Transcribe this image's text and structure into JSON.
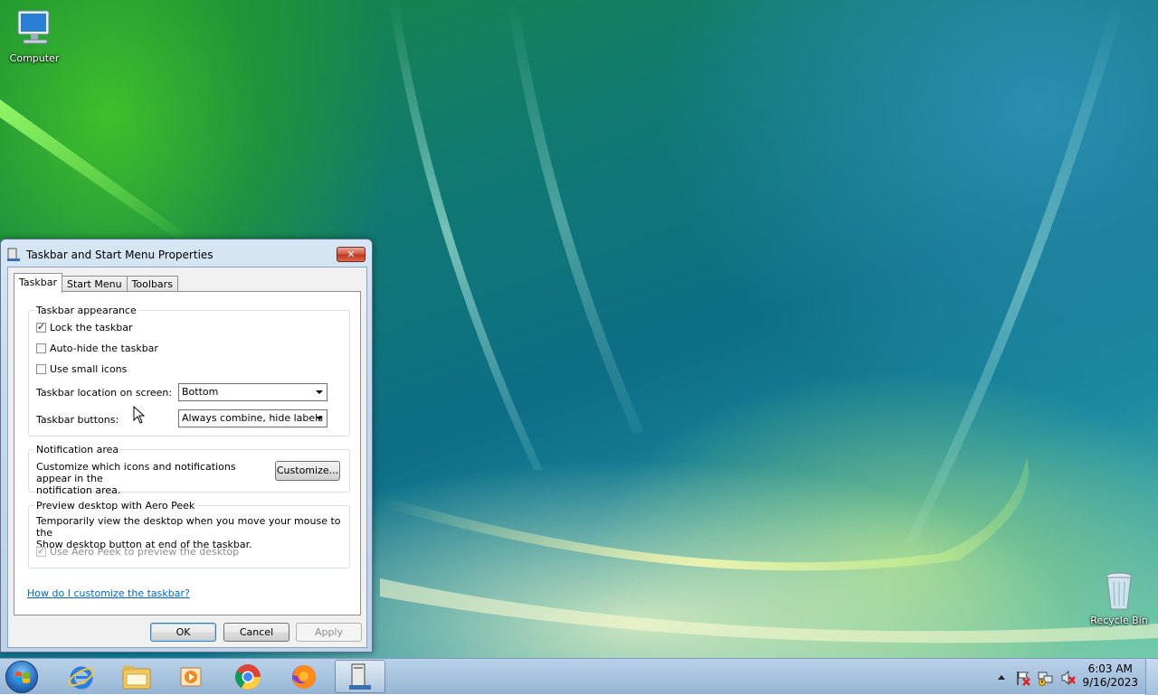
{
  "desktop": {
    "icons": [
      {
        "label": "Computer",
        "icon": "computer-icon"
      },
      {
        "label": "Recycle Bin",
        "icon": "recycle-bin-icon"
      }
    ]
  },
  "dialog": {
    "title": "Taskbar and Start Menu Properties",
    "close_label": "✕",
    "tabs": [
      {
        "label": "Taskbar",
        "active": true
      },
      {
        "label": "Start Menu",
        "active": false
      },
      {
        "label": "Toolbars",
        "active": false
      }
    ],
    "appearance": {
      "title": "Taskbar appearance",
      "lock_label": "Lock the taskbar",
      "lock_checked": true,
      "autohide_label": "Auto-hide the taskbar",
      "autohide_checked": false,
      "small_icons_label": "Use small icons",
      "small_icons_checked": false,
      "location_label": "Taskbar location on screen:",
      "location_value": "Bottom",
      "buttons_label": "Taskbar buttons:",
      "buttons_value": "Always combine, hide labels"
    },
    "notification": {
      "title": "Notification area",
      "text_line1": "Customize which icons and notifications appear in the",
      "text_line2": "notification area.",
      "customize_label": "Customize..."
    },
    "aero_peek": {
      "title": "Preview desktop with Aero Peek",
      "text_line1": "Temporarily view the desktop when you move your mouse to the",
      "text_line2": "Show desktop button at end of the taskbar.",
      "checkbox_label": "Use Aero Peek to preview the desktop",
      "checkbox_checked": true,
      "checkbox_disabled": true
    },
    "help_link": "How do I customize the taskbar?",
    "buttons": {
      "ok": "OK",
      "cancel": "Cancel",
      "apply": "Apply"
    }
  },
  "taskbar": {
    "pinned": [
      {
        "icon": "internet-explorer-icon"
      },
      {
        "icon": "windows-explorer-icon"
      },
      {
        "icon": "media-player-icon"
      },
      {
        "icon": "chrome-icon"
      },
      {
        "icon": "firefox-icon"
      },
      {
        "icon": "taskbar-properties-icon",
        "active": true
      }
    ],
    "tray_icons": [
      "show-hidden-icons-chevron",
      "action-center-flag-icon",
      "network-icon",
      "volume-muted-icon"
    ],
    "time": "6:03 AM",
    "date": "9/16/2023"
  }
}
